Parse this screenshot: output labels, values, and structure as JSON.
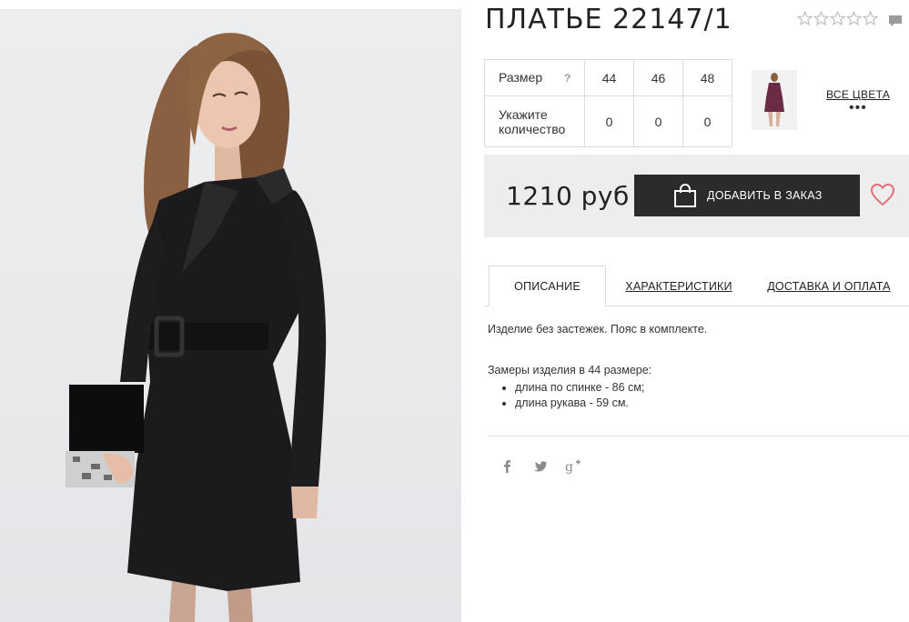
{
  "product": {
    "title": "ПЛАТЬЕ 22147/1",
    "rating_stars": 0,
    "rating_max": 5
  },
  "sizes": {
    "label": "Размер",
    "help": "?",
    "values": [
      "44",
      "46",
      "48"
    ],
    "qty_label_line1": "Укажите",
    "qty_label_line2": "количество",
    "quantities": [
      "0",
      "0",
      "0"
    ]
  },
  "colors": {
    "all_colors_label": "ВСЕ ЦВЕТА",
    "more": "•••"
  },
  "purchase": {
    "price": "1210 руб",
    "add_button_label": "ДОБАВИТЬ В ЗАКАЗ"
  },
  "tabs": [
    {
      "label": "ОПИСАНИЕ"
    },
    {
      "label": "ХАРАКТЕРИСТИКИ"
    },
    {
      "label": "ДОСТАВКА И ОПЛАТА"
    }
  ],
  "description": {
    "text": "Изделие без застежек. Пояс в комплекте.",
    "measurements_heading": "Замеры изделия в 44 размере:",
    "measurements": [
      "длина по спинке - 86 см;",
      "длина рукава - 59 см."
    ]
  },
  "social_icons": [
    "facebook-icon",
    "twitter-icon",
    "google-plus-icon"
  ],
  "colors_palette": {
    "button_bg": "#2b2b2b",
    "price_box_bg": "#ededed",
    "heart": "#e0707a",
    "dress": "#1b1b1d",
    "thumb_dress": "#6b2a45"
  }
}
